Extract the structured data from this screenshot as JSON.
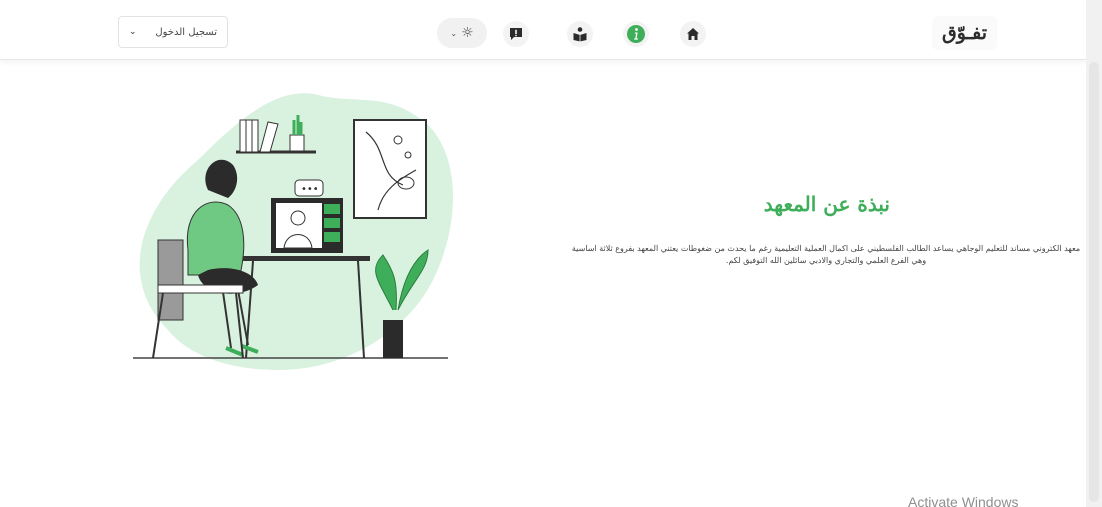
{
  "header": {
    "brand": "تفـوّق",
    "login_label": "تسجيل الدخول",
    "nav": [
      {
        "name": "home",
        "icon": "home-icon"
      },
      {
        "name": "info",
        "icon": "info-icon"
      },
      {
        "name": "reading",
        "icon": "reader-icon"
      },
      {
        "name": "feedback",
        "icon": "feedback-icon"
      }
    ],
    "theme_icon": "sun-icon",
    "accent_color": "#3fae5a"
  },
  "about": {
    "title": "نبذة عن المعهد",
    "text": "معهد الكتروني مساند للتعليم الوجاهي يساعد الطالب الفلسطيني على اكمال العملية التعليمية رغم ما يحدث من ضغوطات يعتني المعهد بفروع ثلاثة اساسية وهي الفرع العلمي والتجاري والادبي سائلين الله التوفيق لكم."
  },
  "watermark": "Activate Windows"
}
